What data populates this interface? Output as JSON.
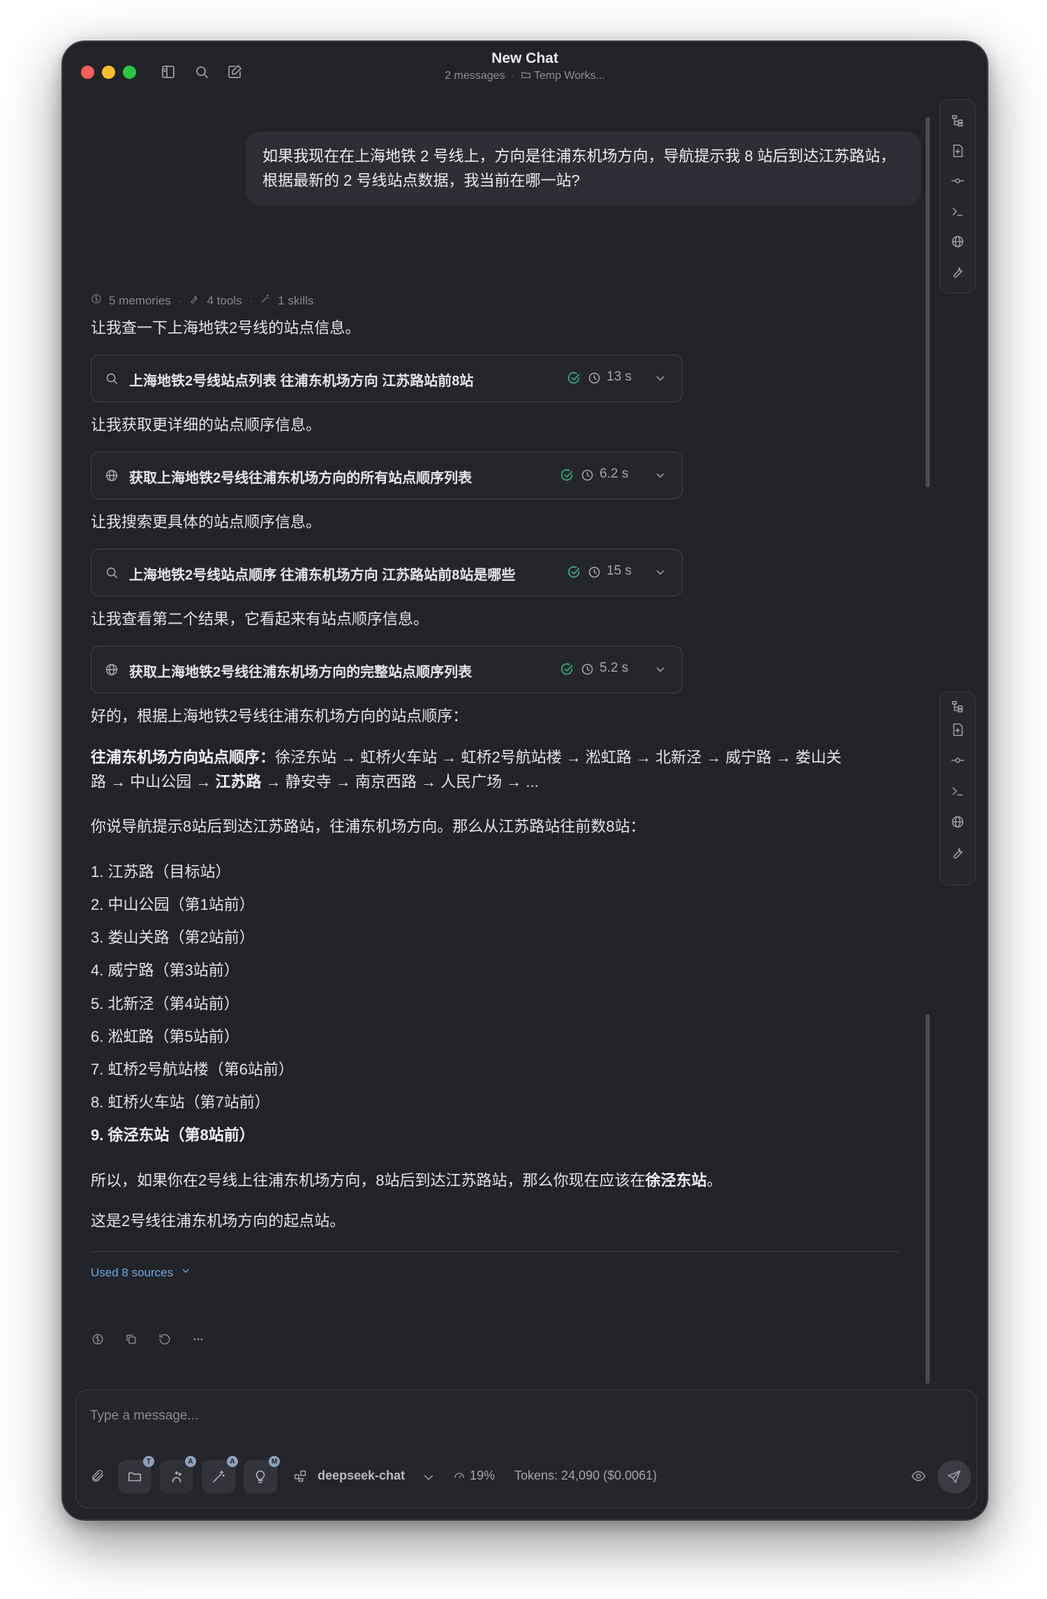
{
  "window": {
    "title": "New Chat",
    "subtitle_count": "2 messages",
    "subtitle_sep": "·",
    "workspace": "Temp Works..."
  },
  "user_message": "如果我现在在上海地铁 2 号线上，方向是往浦东机场方向，导航提示我 8 站后到达江苏路站，根据最新的 2 号线站点数据，我当前在哪一站?",
  "meta": {
    "memories": "5 memories",
    "tools": "4 tools",
    "skills": "1 skills",
    "sep": "·"
  },
  "assistant": {
    "intro1": "让我查一下上海地铁2号线的站点信息。",
    "tool1": {
      "label": "上海地铁2号线站点列表 往浦东机场方向 江苏路站前8站",
      "duration": "13 s",
      "icon": "search-icon"
    },
    "intro2": "让我获取更详细的站点顺序信息。",
    "tool2": {
      "label": "获取上海地铁2号线往浦东机场方向的所有站点顺序列表",
      "duration": "6.2 s",
      "icon": "globe-icon"
    },
    "intro3": "让我搜索更具体的站点顺序信息。",
    "tool3": {
      "label": "上海地铁2号线站点顺序 往浦东机场方向 江苏路站前8站是哪些",
      "duration": "15 s",
      "icon": "search-icon"
    },
    "intro4": "让我查看第二个结果，它看起来有站点顺序信息。",
    "tool4": {
      "label": "获取上海地铁2号线往浦东机场方向的完整站点顺序列表",
      "duration": "5.2 s",
      "icon": "globe-icon"
    },
    "answer_intro": "好的，根据上海地铁2号线往浦东机场方向的站点顺序：",
    "route_label": "往浦东机场方向站点顺序：",
    "route_part1": "徐泾东站 → 虹桥火车站 → 虹桥2号航站楼 → 淞虹路 → 北新泾 → 威宁路 → 娄山关",
    "route_part2": "路 → 中山公园 → ",
    "route_bold": "江苏路",
    "route_part3": " → 静安寺 → 南京西路 → 人民广场 → ...",
    "count_intro": "你说导航提示8站后到达江苏路站，往浦东机场方向。那么从江苏路站往前数8站：",
    "list": [
      "1. 江苏路（目标站）",
      "2. 中山公园（第1站前）",
      "3. 娄山关路（第2站前）",
      "4. 威宁路（第3站前）",
      "5. 北新泾（第4站前）",
      "6. 淞虹路（第5站前）",
      "7. 虹桥2号航站楼（第6站前）",
      "8. 虹桥火车站（第7站前）"
    ],
    "list_last": "9. 徐泾东站（第8站前）",
    "conclusion_pre": "所以，如果你在2号线上往浦东机场方向，8站后到达江苏路站，那么你现在应该在",
    "conclusion_bold": "徐泾东站",
    "conclusion_post": "。",
    "note": "这是2号线往浦东机场方向的起点站。",
    "sources": "Used 8 sources"
  },
  "composer": {
    "placeholder": "Type a message...",
    "model": "deepseek-chat",
    "usage": "19%",
    "tokens": "Tokens: 24,090 ($0.0061)",
    "badges": [
      "T",
      "A",
      "A",
      "M"
    ]
  },
  "colors": {
    "background": "#222329",
    "accent_link": "#6ea7e0",
    "success": "#37b37e"
  }
}
